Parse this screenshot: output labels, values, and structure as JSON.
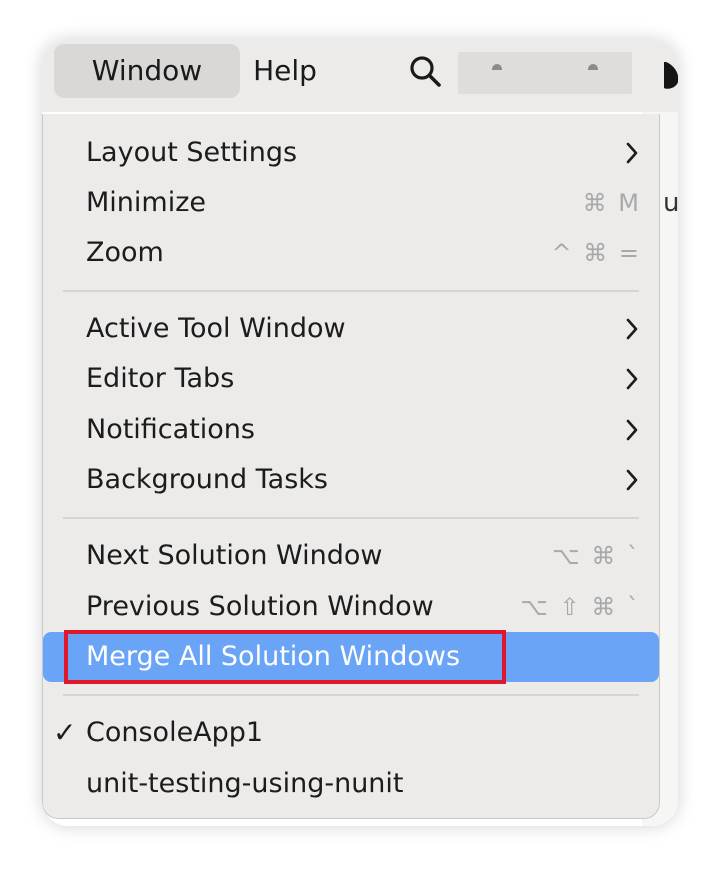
{
  "menubar": {
    "window_label": "Window",
    "help_label": "Help",
    "search_icon": "search-icon",
    "blurred_region": "redacted-status-items",
    "account_icon": "account-icon"
  },
  "menu": {
    "items": [
      {
        "label": "Layout Settings",
        "type": "submenu"
      },
      {
        "label": "Minimize",
        "shortcut": "⌘ M"
      },
      {
        "label": "Zoom",
        "shortcut": "^ ⌘ ="
      },
      {
        "label": "Active Tool Window",
        "type": "submenu"
      },
      {
        "label": "Editor Tabs",
        "type": "submenu"
      },
      {
        "label": "Notifications",
        "type": "submenu"
      },
      {
        "label": "Background Tasks",
        "type": "submenu"
      },
      {
        "label": "Next Solution Window",
        "shortcut": "⌥ ⌘ `"
      },
      {
        "label": "Previous Solution Window",
        "shortcut": "⌥ ⇧ ⌘ `"
      },
      {
        "label": "Merge All Solution Windows",
        "highlighted": true
      },
      {
        "label": "ConsoleApp1",
        "checked": true,
        "check_mark": "✓"
      },
      {
        "label": "unit-testing-using-nunit"
      }
    ]
  },
  "background_window": {
    "peek_text": "u"
  },
  "colors": {
    "menu_bg": "#ecebea",
    "highlight": "#6aa4f7",
    "annotation_border": "#e0182d",
    "shortcut_text": "#a9a9a9"
  }
}
